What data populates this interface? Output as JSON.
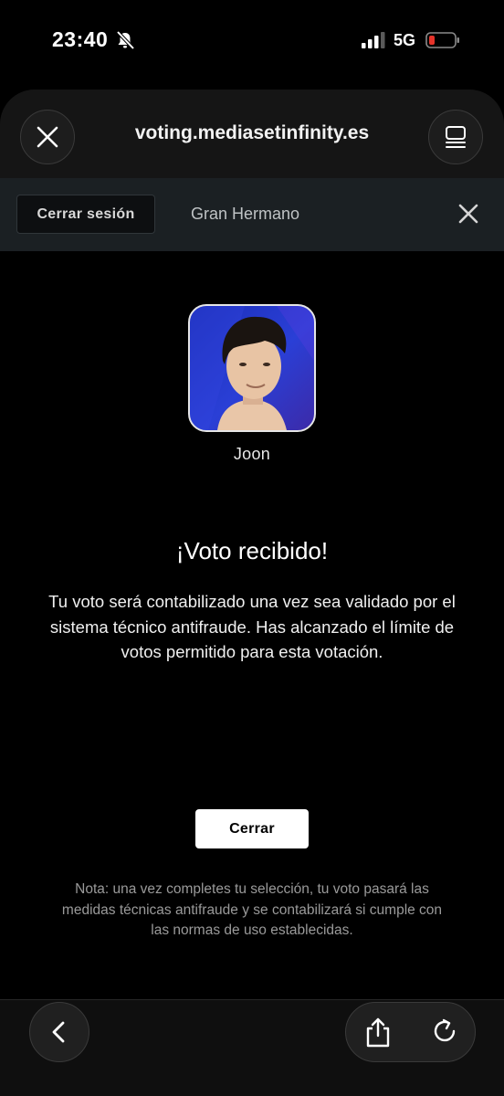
{
  "status_bar": {
    "time": "23:40",
    "network": "5G",
    "icons": [
      "bell-slash-icon",
      "signal-bars-icon",
      "battery-low-icon"
    ],
    "battery_color": "#e5332a"
  },
  "browser": {
    "url": "voting.mediasetinfinity.es",
    "icons": [
      "close-icon",
      "tabs-icon",
      "back-icon",
      "share-icon",
      "reload-icon"
    ]
  },
  "header": {
    "logout_label": "Cerrar sesión",
    "show_name": "Gran Hermano"
  },
  "contestant": {
    "name": "Joon"
  },
  "result": {
    "title": "¡Voto recibido!",
    "message": "Tu voto será contabilizado una vez sea validado por el sistema técnico antifraude. Has alcanzado el límite de votos permitido para esta votación."
  },
  "actions": {
    "close_label": "Cerrar"
  },
  "note": "Nota: una vez completes tu selección, tu voto pasará las medidas técnicas antifraude y se contabilizará si cumple con las normas de uso establecidas.",
  "colors": {
    "header_bg": "#1b2023",
    "avatar_bg": "#2a3fd6",
    "background": "#000000"
  }
}
